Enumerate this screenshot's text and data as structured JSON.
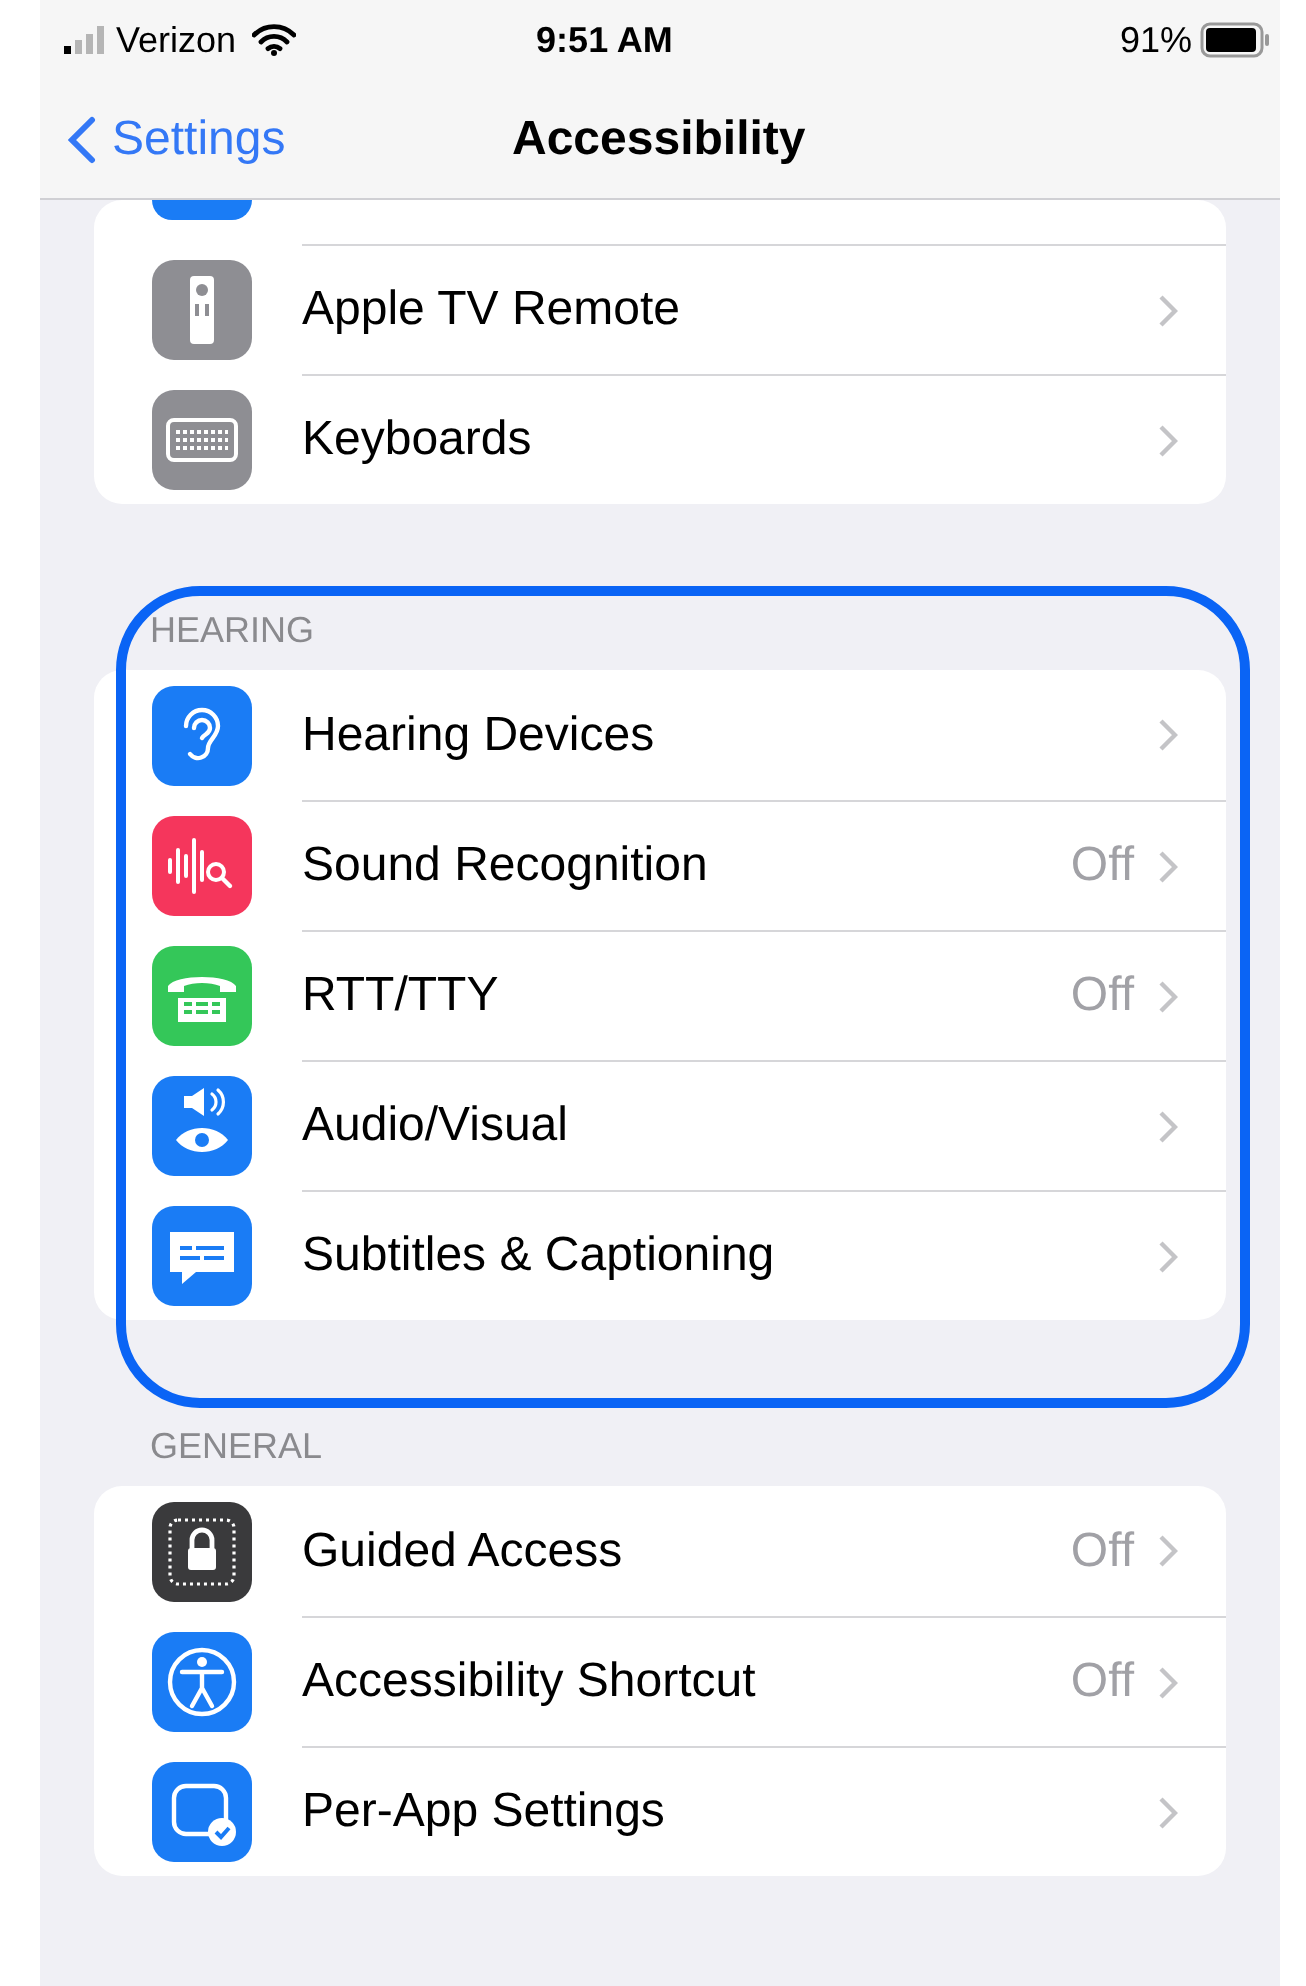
{
  "status_bar": {
    "carrier": "Verizon",
    "time": "9:51 AM",
    "battery": "91%"
  },
  "nav": {
    "back": "Settings",
    "title": "Accessibility"
  },
  "sections": [
    {
      "cut_top": true,
      "highlighted": false,
      "rows": [
        {
          "label": "Apple TV Remote",
          "color": "#8e8e93"
        },
        {
          "label": "Keyboards",
          "color": "#8e8e93"
        }
      ]
    },
    {
      "header": "HEARING",
      "highlighted": true,
      "rows": [
        {
          "label": "Hearing Devices",
          "color": "#1a7cf5"
        },
        {
          "label": "Sound Recognition",
          "value": "Off",
          "color": "#f5365c"
        },
        {
          "label": "RTT/TTY",
          "value": "Off",
          "color": "#34c759"
        },
        {
          "label": "Audio/Visual",
          "color": "#1a7cf5"
        },
        {
          "label": "Subtitles & Captioning",
          "color": "#1a7cf5"
        }
      ]
    },
    {
      "header": "GENERAL",
      "highlighted": false,
      "rows": [
        {
          "label": "Guided Access",
          "value": "Off",
          "color": "#3a3a3c"
        },
        {
          "label": "Accessibility Shortcut",
          "value": "Off",
          "color": "#1a7cf5"
        },
        {
          "label": "Per-App Settings",
          "color": "#1a7cf5"
        }
      ]
    }
  ]
}
